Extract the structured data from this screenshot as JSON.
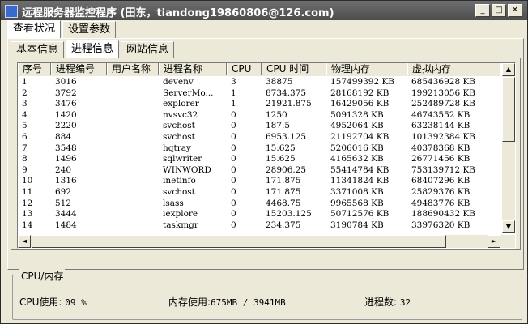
{
  "window": {
    "title": "远程服务器监控程序 (田东，tiandong19860806@126.com)",
    "controls": [
      "_",
      "□",
      "✕"
    ]
  },
  "tabs_top": [
    {
      "label": "查看状况",
      "active": true
    },
    {
      "label": "设置参数",
      "active": false
    }
  ],
  "tabs_inner": [
    {
      "label": "基本信息",
      "active": false
    },
    {
      "label": "进程信息",
      "active": true
    },
    {
      "label": "网站信息",
      "active": false
    }
  ],
  "process_table": {
    "columns": [
      "序号",
      "进程编号",
      "用户名称",
      "进程名称",
      "CPU",
      "CPU 时间",
      "物理内存",
      "虚拟内存"
    ],
    "rows": [
      [
        "1",
        "3016",
        "",
        "devenv",
        "3",
        "38875",
        "157499392 KB",
        "685436928 KB"
      ],
      [
        "2",
        "3792",
        "",
        "ServerMo...",
        "1",
        "8734.375",
        "28168192 KB",
        "199213056 KB"
      ],
      [
        "3",
        "3476",
        "",
        "explorer",
        "1",
        "21921.875",
        "16429056 KB",
        "252489728 KB"
      ],
      [
        "4",
        "1420",
        "",
        "nvsvc32",
        "0",
        "1250",
        "5091328 KB",
        "46743552 KB"
      ],
      [
        "5",
        "2220",
        "",
        "svchost",
        "0",
        "187.5",
        "4952064 KB",
        "63238144 KB"
      ],
      [
        "6",
        "884",
        "",
        "svchost",
        "0",
        "6953.125",
        "21192704 KB",
        "101392384 KB"
      ],
      [
        "7",
        "3548",
        "",
        "hqtray",
        "0",
        "15.625",
        "5206016 KB",
        "40378368 KB"
      ],
      [
        "8",
        "1496",
        "",
        "sqlwriter",
        "0",
        "15.625",
        "4165632 KB",
        "26771456 KB"
      ],
      [
        "9",
        "240",
        "",
        "WINWORD",
        "0",
        "28906.25",
        "55414784 KB",
        "753139712 KB"
      ],
      [
        "10",
        "1316",
        "",
        "inetinfo",
        "0",
        "171.875",
        "11341824 KB",
        "68407296 KB"
      ],
      [
        "11",
        "692",
        "",
        "svchost",
        "0",
        "171.875",
        "3371008 KB",
        "25829376 KB"
      ],
      [
        "12",
        "512",
        "",
        "lsass",
        "0",
        "4468.75",
        "9965568 KB",
        "49483776 KB"
      ],
      [
        "13",
        "3444",
        "",
        "iexplore",
        "0",
        "15203.125",
        "50712576 KB",
        "188690432 KB"
      ],
      [
        "14",
        "1484",
        "",
        "taskmgr",
        "0",
        "234.375",
        "3190784 KB",
        "33976320 KB"
      ]
    ]
  },
  "scrollbar_icons": {
    "up": "▲",
    "down": "▼",
    "left": "◄",
    "right": "►"
  },
  "cpu_mem": {
    "title": "CPU/内存",
    "cpu_label": "CPU使用:",
    "cpu_value": "09 %",
    "mem_label": "内存使用:",
    "mem_value": "675MB / 3941MB",
    "proc_label": "进程数:",
    "proc_value": "32"
  }
}
